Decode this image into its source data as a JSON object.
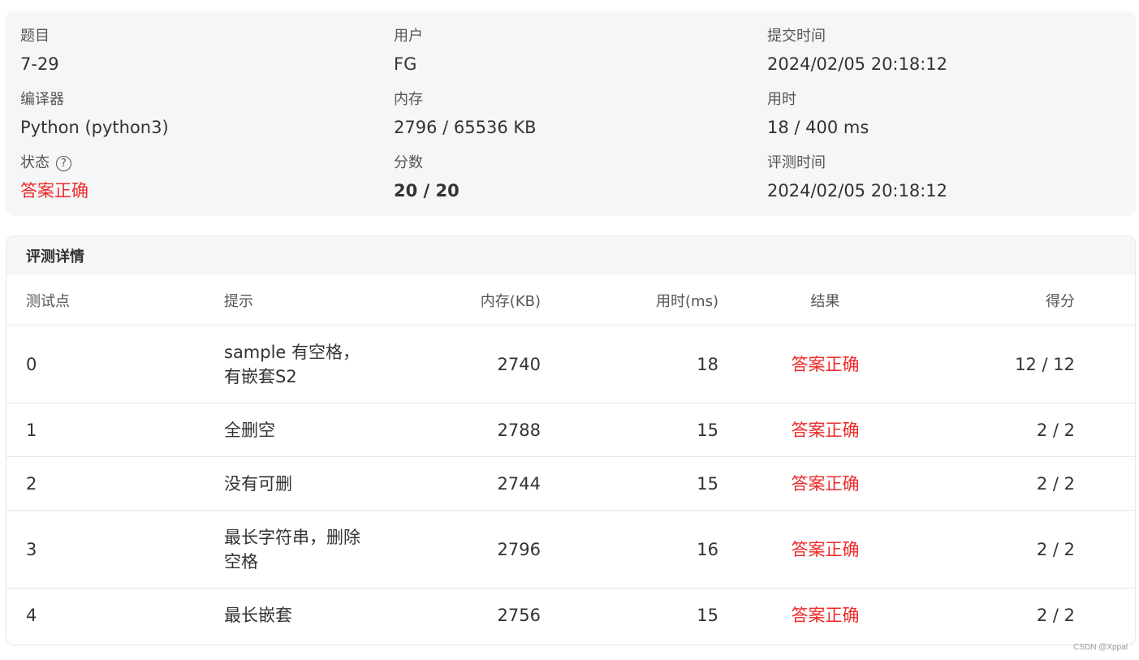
{
  "summary": {
    "problem_label": "题目",
    "problem_value": "7-29",
    "user_label": "用户",
    "user_value": "FG",
    "submit_time_label": "提交时间",
    "submit_time_value": "2024/02/05 20:18:12",
    "compiler_label": "编译器",
    "compiler_value": "Python (python3)",
    "memory_label": "内存",
    "memory_value": "2796 / 65536 KB",
    "time_label": "用时",
    "time_value": "18 / 400 ms",
    "status_label": "状态",
    "status_value": "答案正确",
    "score_label": "分数",
    "score_value": "20 / 20",
    "judge_time_label": "评测时间",
    "judge_time_value": "2024/02/05 20:18:12",
    "status_color": "#ee2a2a"
  },
  "details": {
    "title": "评测详情",
    "headers": {
      "case": "测试点",
      "hint": "提示",
      "memory": "内存(KB)",
      "time": "用时(ms)",
      "result": "结果",
      "score": "得分"
    },
    "rows": [
      {
        "case": "0",
        "hint": "sample 有空格，有嵌套S2",
        "memory": "2740",
        "time": "18",
        "result": "答案正确",
        "score": "12 / 12"
      },
      {
        "case": "1",
        "hint": "全删空",
        "memory": "2788",
        "time": "15",
        "result": "答案正确",
        "score": "2 / 2"
      },
      {
        "case": "2",
        "hint": "没有可删",
        "memory": "2744",
        "time": "15",
        "result": "答案正确",
        "score": "2 / 2"
      },
      {
        "case": "3",
        "hint": "最长字符串，删除空格",
        "memory": "2796",
        "time": "16",
        "result": "答案正确",
        "score": "2 / 2"
      },
      {
        "case": "4",
        "hint": "最长嵌套",
        "memory": "2756",
        "time": "15",
        "result": "答案正确",
        "score": "2 / 2"
      }
    ]
  },
  "watermark": "CSDN @Xppal",
  "icons": {
    "help": "help-circle-icon"
  }
}
